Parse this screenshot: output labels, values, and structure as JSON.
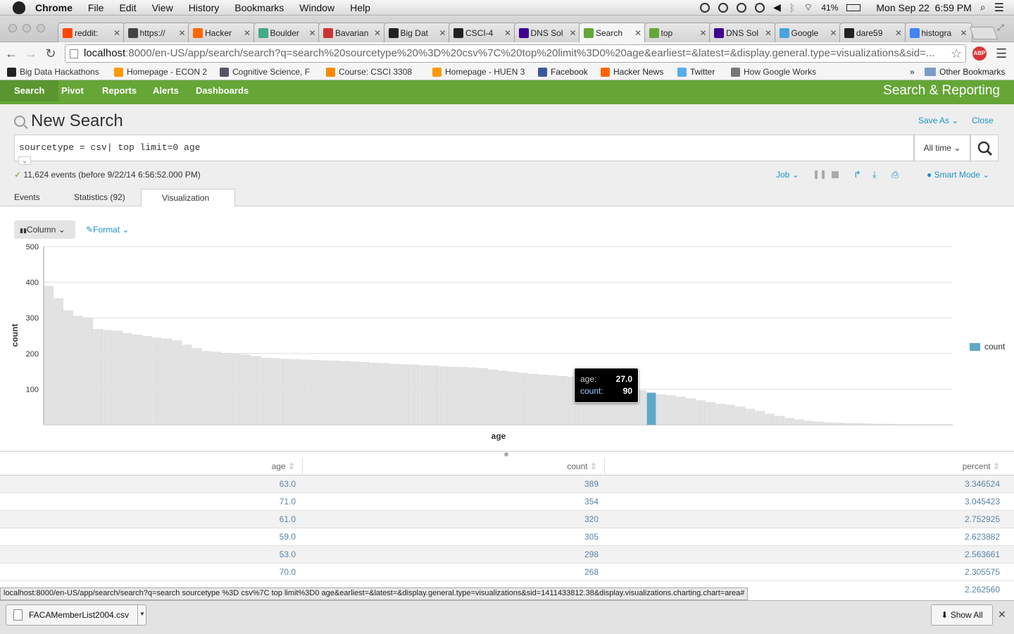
{
  "menubar": {
    "app": "Chrome",
    "menus": [
      "File",
      "Edit",
      "View",
      "History",
      "Bookmarks",
      "Window",
      "Help"
    ],
    "battery": "41%",
    "clock": "Mon Sep 22  6:59 PM"
  },
  "tabs": [
    {
      "title": "reddit:",
      "icon": "reddit-icon",
      "color": "#ff4500"
    },
    {
      "title": "https://",
      "icon": "github-cat-icon",
      "color": "#444"
    },
    {
      "title": "Hacker",
      "icon": "ycombinator-icon",
      "color": "#ff6600"
    },
    {
      "title": "Boulder",
      "icon": "maps-icon",
      "color": "#4a8"
    },
    {
      "title": "Bavarian",
      "icon": "bavarian-icon",
      "color": "#c33"
    },
    {
      "title": "Big Dat",
      "icon": "medium-icon",
      "color": "#222"
    },
    {
      "title": "CSCI-4",
      "icon": "github-icon",
      "color": "#222"
    },
    {
      "title": "DNS Sol",
      "icon": "yahoo-icon",
      "color": "#400090"
    },
    {
      "title": "Search",
      "icon": "splunk-icon",
      "color": "#65a637",
      "active": true
    },
    {
      "title": "top",
      "icon": "splunk-icon",
      "color": "#65a637"
    },
    {
      "title": "DNS Sol",
      "icon": "yahoo-icon",
      "color": "#400090"
    },
    {
      "title": "Google",
      "icon": "google-chrome-icon",
      "color": "#4aa3df"
    },
    {
      "title": "dare59",
      "icon": "github-icon",
      "color": "#222"
    },
    {
      "title": "histogra",
      "icon": "google-icon",
      "color": "#4285f4"
    }
  ],
  "address": {
    "host": "localhost",
    "rest": ":8000/en-US/app/search/search?q=search%20sourcetype%20%3D%20csv%7C%20top%20limit%3D0%20age&earliest=&latest=&display.general.type=visualizations&sid=..."
  },
  "bookmarks": [
    {
      "label": "Big Data Hackathons",
      "icon": "medium-icon",
      "color": "#222",
      "fade": true
    },
    {
      "label": "Homepage - ECON 2",
      "icon": "asterisk-icon",
      "color": "#f90",
      "fade": true
    },
    {
      "label": "Cognitive Science, F",
      "icon": "gear-icon",
      "color": "#556",
      "fade": true
    },
    {
      "label": "Course: CSCI 3308",
      "icon": "moodle-icon",
      "color": "#f80",
      "fade": true
    },
    {
      "label": "Homepage - HUEN 3",
      "icon": "asterisk-icon",
      "color": "#f90",
      "fade": true
    },
    {
      "label": "Facebook",
      "icon": "facebook-icon",
      "color": "#3b5998"
    },
    {
      "label": "Hacker News",
      "icon": "ycombinator-icon",
      "color": "#ff6600"
    },
    {
      "label": "Twitter",
      "icon": "twitter-icon",
      "color": "#55acee"
    },
    {
      "label": "How Google Works",
      "icon": "feather-icon",
      "color": "#777",
      "fade": true
    }
  ],
  "bookmarks_more": "»",
  "other_bookmarks": "Other Bookmarks",
  "appbar": {
    "nav": [
      "Search",
      "Pivot",
      "Reports",
      "Alerts",
      "Dashboards"
    ],
    "app_name": "Search & Reporting"
  },
  "search": {
    "title": "New Search",
    "save_as": "Save As",
    "close": "Close",
    "query": "sourcetype = csv| top limit=0 age",
    "time_range": "All time",
    "status": "11,624 events (before 9/22/14 6:56:52.000 PM)",
    "job": "Job",
    "mode": "Smart Mode"
  },
  "result_tabs": [
    "Events",
    "Statistics (92)",
    "Visualization"
  ],
  "viz_controls": {
    "type": "Column",
    "format": "Format"
  },
  "chart_data": {
    "type": "bar",
    "xlabel": "age",
    "ylabel": "count",
    "ylim": [
      0,
      500
    ],
    "yticks": [
      100,
      200,
      300,
      400,
      500
    ],
    "legend": "right",
    "series": [
      {
        "name": "count",
        "color": "#5ea9c6"
      }
    ],
    "highlight_index": 61,
    "values": [
      389,
      354,
      320,
      305,
      298,
      268,
      265,
      263,
      256,
      252,
      248,
      244,
      241,
      236,
      224,
      214,
      206,
      204,
      201,
      198,
      196,
      192,
      187,
      186,
      184,
      183,
      182,
      181,
      180,
      179,
      178,
      176,
      175,
      173,
      172,
      170,
      169,
      168,
      166,
      165,
      163,
      162,
      161,
      160,
      158,
      154,
      151,
      148,
      145,
      142,
      140,
      138,
      136,
      134,
      132,
      130,
      129,
      127,
      124,
      121,
      96,
      90,
      85,
      82,
      78,
      73,
      68,
      63,
      58,
      55,
      50,
      44,
      38,
      30,
      24,
      18,
      14,
      10,
      8,
      6,
      5,
      4,
      4,
      3,
      2,
      2,
      1,
      1,
      1,
      1,
      1,
      1
    ],
    "tooltip": {
      "age_label": "age:",
      "age_value": "27.0",
      "count_label": "count:",
      "count_value": "90"
    }
  },
  "table": {
    "columns": [
      "age",
      "count",
      "percent"
    ],
    "rows": [
      [
        "63.0",
        "389",
        "3.346524"
      ],
      [
        "71.0",
        "354",
        "3.045423"
      ],
      [
        "61.0",
        "320",
        "2.752925"
      ],
      [
        "59.0",
        "305",
        "2.623882"
      ],
      [
        "53.0",
        "298",
        "2.563661"
      ],
      [
        "70.0",
        "268",
        "2.305575"
      ]
    ],
    "partial_percent": "2.262560"
  },
  "status_url": "localhost:8000/en-US/app/search/search?q=search sourcetype %3D csv%7C top limit%3D0 age&earliest=&latest=&display.general.type=visualizations&sid=1411433812.38&display.visualizations.charting.chart=area#",
  "download": {
    "file": "FACAMemberList2004.csv",
    "show_all": "Show All"
  }
}
